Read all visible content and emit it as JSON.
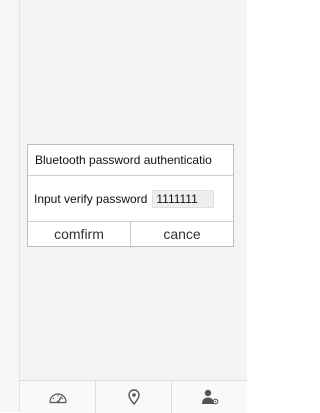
{
  "dialog": {
    "title": "Bluetooth password authenticatio",
    "input_label": "Input verify password",
    "password_value": "1111111",
    "confirm_label": "comfirm",
    "cancel_label": "cance"
  },
  "bottom_nav": {
    "items": [
      {
        "icon": "speedometer-icon"
      },
      {
        "icon": "location-pin-icon"
      },
      {
        "icon": "user-settings-icon"
      }
    ]
  },
  "colors": {
    "background": "#f4f4f4",
    "dialog_border": "#bdbdbd",
    "field_bg": "#eeeeee",
    "icon": "#555555"
  }
}
